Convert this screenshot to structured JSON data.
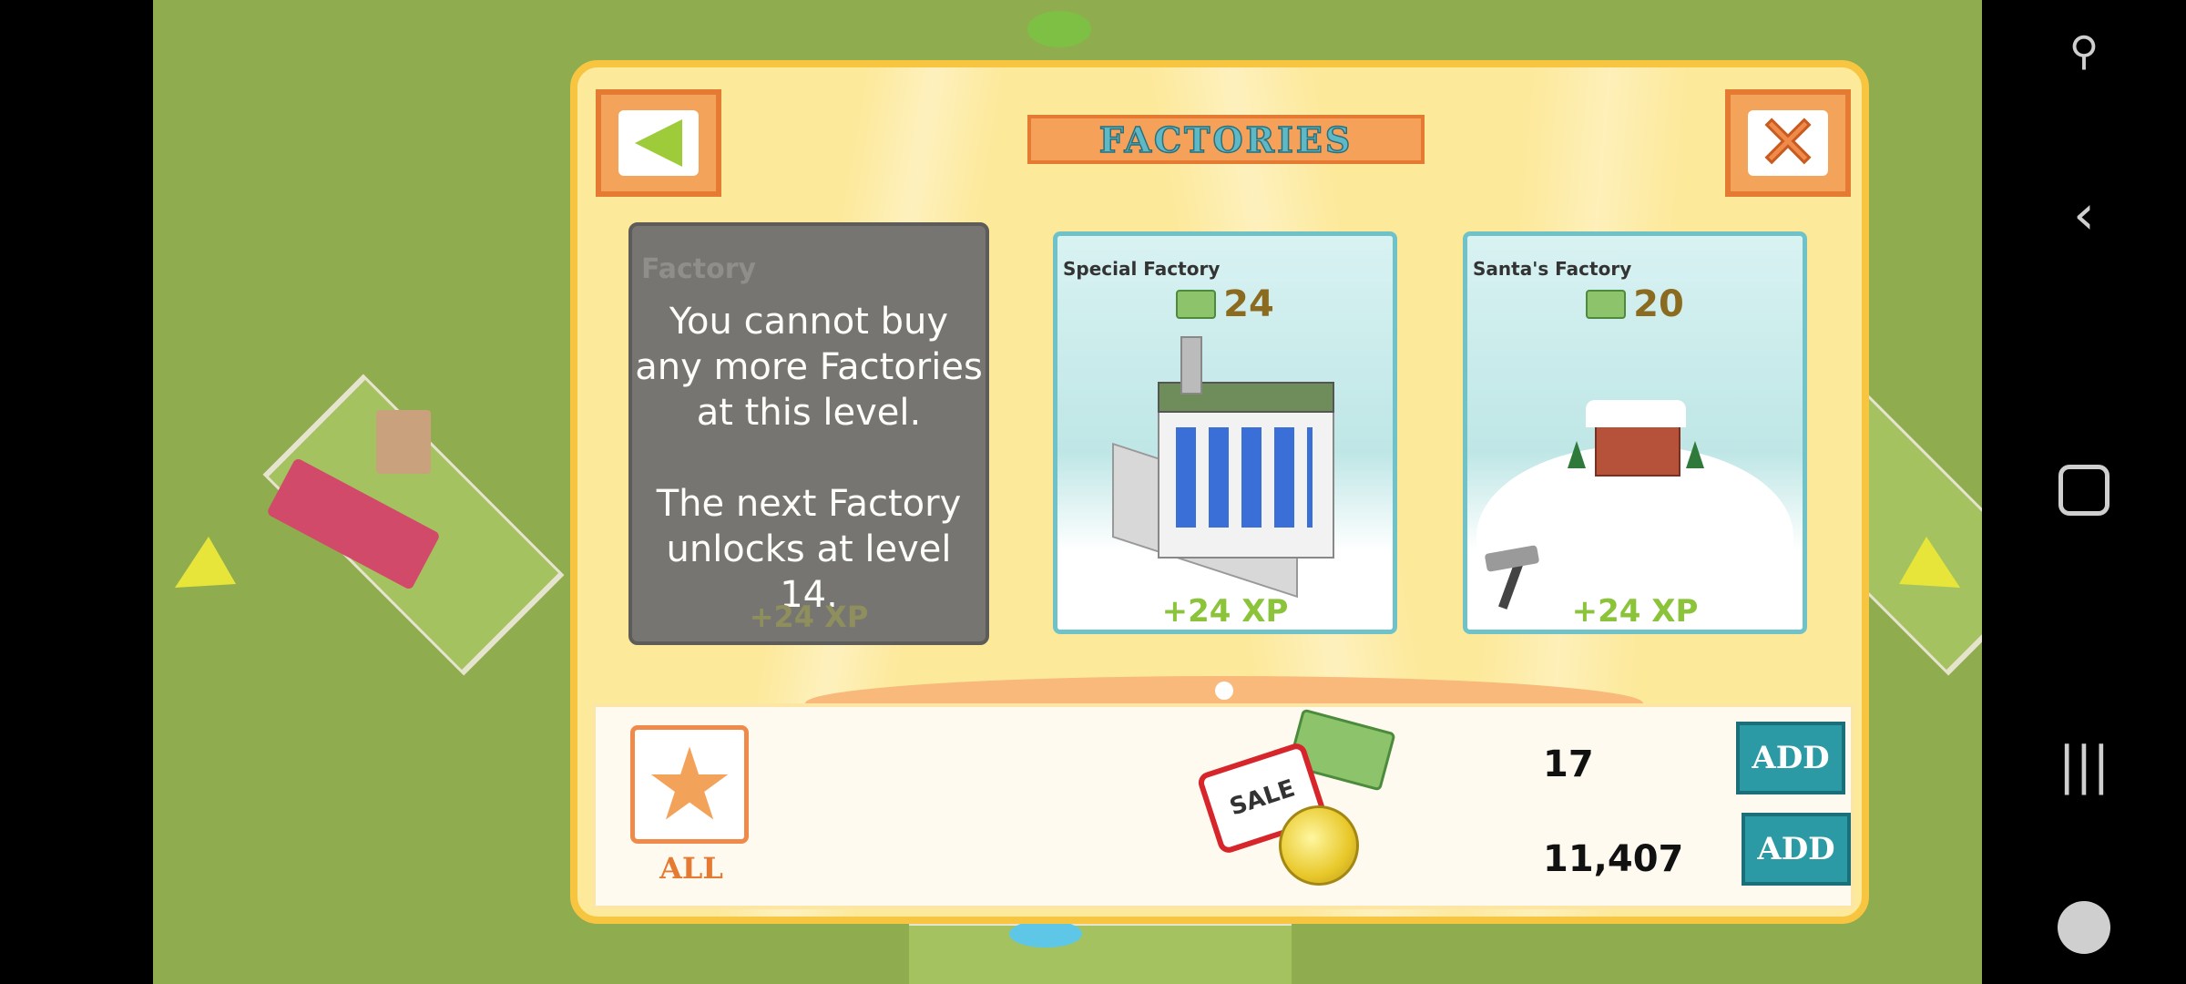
{
  "dialog": {
    "title": "FACTORIES"
  },
  "locked_card": {
    "ghost_name": "Factory",
    "ghost_xp": "+24 XP",
    "message": "You cannot buy any more Factories at this level.\n\nThe next Factory unlocks at level 14."
  },
  "cards": [
    {
      "name": "Special Factory",
      "price": "24",
      "xp": "+24 XP"
    },
    {
      "name": "Santa's Factory",
      "price": "20",
      "xp": "+24 XP"
    }
  ],
  "bottom": {
    "all_label": "ALL",
    "cash": "17",
    "coins": "11,407",
    "add_label": "ADD",
    "sale_label": "SALE"
  },
  "colors": {
    "grass": "#8fad4f",
    "dialog_bg": "#fde99a",
    "add_button": "#2c9aa5",
    "xp_text": "#8bc43a"
  }
}
